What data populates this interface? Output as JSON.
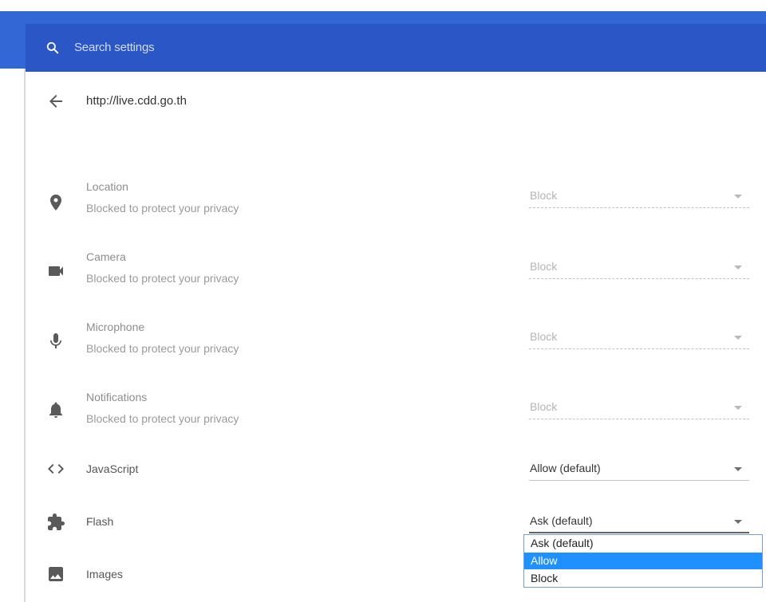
{
  "search": {
    "placeholder": "Search settings",
    "icon": "search-icon"
  },
  "site": {
    "back_icon": "arrow-back-icon",
    "url": "http://live.cdd.go.th"
  },
  "permissions": [
    {
      "key": "location",
      "icon": "location-pin-icon",
      "title": "Location",
      "subtitle": "Blocked to protect your privacy",
      "value": "Block",
      "disabled": true
    },
    {
      "key": "camera",
      "icon": "camera-icon",
      "title": "Camera",
      "subtitle": "Blocked to protect your privacy",
      "value": "Block",
      "disabled": true
    },
    {
      "key": "microphone",
      "icon": "microphone-icon",
      "title": "Microphone",
      "subtitle": "Blocked to protect your privacy",
      "value": "Block",
      "disabled": true
    },
    {
      "key": "notifications",
      "icon": "bell-icon",
      "title": "Notifications",
      "subtitle": "Blocked to protect your privacy",
      "value": "Block",
      "disabled": true
    },
    {
      "key": "javascript",
      "icon": "code-icon",
      "title": "JavaScript",
      "value": "Allow (default)",
      "disabled": false
    },
    {
      "key": "flash",
      "icon": "puzzle-icon",
      "title": "Flash",
      "value": "Ask (default)",
      "disabled": false
    },
    {
      "key": "images",
      "icon": "image-icon",
      "title": "Images"
    }
  ],
  "flash_dropdown": {
    "options": [
      "Ask (default)",
      "Allow",
      "Block"
    ],
    "highlighted": "Allow"
  },
  "colors": {
    "header": "#3367d6",
    "search_box": "#2a56c6",
    "highlight": "#1e90ff"
  }
}
